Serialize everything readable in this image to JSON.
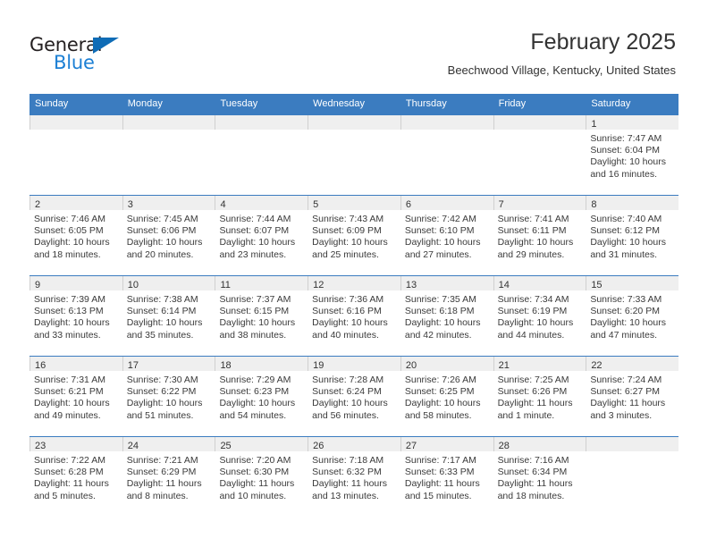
{
  "brand": {
    "name_part1": "General",
    "name_part2": "Blue",
    "triangle_icon": "triangle-icon",
    "accent_color": "#1b7fd4",
    "logo_dark_color": "#231f20"
  },
  "header": {
    "title": "February 2025",
    "subtitle": "Beechwood Village, Kentucky, United States"
  },
  "theme": {
    "header_blue": "#3b7cc0",
    "day_band_gray": "#efefef",
    "text_color": "#333333"
  },
  "calendar": {
    "weekdays": [
      "Sunday",
      "Monday",
      "Tuesday",
      "Wednesday",
      "Thursday",
      "Friday",
      "Saturday"
    ],
    "weeks": [
      [
        {
          "day": "",
          "empty": true,
          "sunrise": "",
          "sunset": "",
          "daylight_line1": "",
          "daylight_line2": ""
        },
        {
          "day": "",
          "empty": true,
          "sunrise": "",
          "sunset": "",
          "daylight_line1": "",
          "daylight_line2": ""
        },
        {
          "day": "",
          "empty": true,
          "sunrise": "",
          "sunset": "",
          "daylight_line1": "",
          "daylight_line2": ""
        },
        {
          "day": "",
          "empty": true,
          "sunrise": "",
          "sunset": "",
          "daylight_line1": "",
          "daylight_line2": ""
        },
        {
          "day": "",
          "empty": true,
          "sunrise": "",
          "sunset": "",
          "daylight_line1": "",
          "daylight_line2": ""
        },
        {
          "day": "",
          "empty": true,
          "sunrise": "",
          "sunset": "",
          "daylight_line1": "",
          "daylight_line2": ""
        },
        {
          "day": "1",
          "sunrise": "Sunrise: 7:47 AM",
          "sunset": "Sunset: 6:04 PM",
          "daylight_line1": "Daylight: 10 hours",
          "daylight_line2": "and 16 minutes."
        }
      ],
      [
        {
          "day": "2",
          "sunrise": "Sunrise: 7:46 AM",
          "sunset": "Sunset: 6:05 PM",
          "daylight_line1": "Daylight: 10 hours",
          "daylight_line2": "and 18 minutes."
        },
        {
          "day": "3",
          "sunrise": "Sunrise: 7:45 AM",
          "sunset": "Sunset: 6:06 PM",
          "daylight_line1": "Daylight: 10 hours",
          "daylight_line2": "and 20 minutes."
        },
        {
          "day": "4",
          "sunrise": "Sunrise: 7:44 AM",
          "sunset": "Sunset: 6:07 PM",
          "daylight_line1": "Daylight: 10 hours",
          "daylight_line2": "and 23 minutes."
        },
        {
          "day": "5",
          "sunrise": "Sunrise: 7:43 AM",
          "sunset": "Sunset: 6:09 PM",
          "daylight_line1": "Daylight: 10 hours",
          "daylight_line2": "and 25 minutes."
        },
        {
          "day": "6",
          "sunrise": "Sunrise: 7:42 AM",
          "sunset": "Sunset: 6:10 PM",
          "daylight_line1": "Daylight: 10 hours",
          "daylight_line2": "and 27 minutes."
        },
        {
          "day": "7",
          "sunrise": "Sunrise: 7:41 AM",
          "sunset": "Sunset: 6:11 PM",
          "daylight_line1": "Daylight: 10 hours",
          "daylight_line2": "and 29 minutes."
        },
        {
          "day": "8",
          "sunrise": "Sunrise: 7:40 AM",
          "sunset": "Sunset: 6:12 PM",
          "daylight_line1": "Daylight: 10 hours",
          "daylight_line2": "and 31 minutes."
        }
      ],
      [
        {
          "day": "9",
          "sunrise": "Sunrise: 7:39 AM",
          "sunset": "Sunset: 6:13 PM",
          "daylight_line1": "Daylight: 10 hours",
          "daylight_line2": "and 33 minutes."
        },
        {
          "day": "10",
          "sunrise": "Sunrise: 7:38 AM",
          "sunset": "Sunset: 6:14 PM",
          "daylight_line1": "Daylight: 10 hours",
          "daylight_line2": "and 35 minutes."
        },
        {
          "day": "11",
          "sunrise": "Sunrise: 7:37 AM",
          "sunset": "Sunset: 6:15 PM",
          "daylight_line1": "Daylight: 10 hours",
          "daylight_line2": "and 38 minutes."
        },
        {
          "day": "12",
          "sunrise": "Sunrise: 7:36 AM",
          "sunset": "Sunset: 6:16 PM",
          "daylight_line1": "Daylight: 10 hours",
          "daylight_line2": "and 40 minutes."
        },
        {
          "day": "13",
          "sunrise": "Sunrise: 7:35 AM",
          "sunset": "Sunset: 6:18 PM",
          "daylight_line1": "Daylight: 10 hours",
          "daylight_line2": "and 42 minutes."
        },
        {
          "day": "14",
          "sunrise": "Sunrise: 7:34 AM",
          "sunset": "Sunset: 6:19 PM",
          "daylight_line1": "Daylight: 10 hours",
          "daylight_line2": "and 44 minutes."
        },
        {
          "day": "15",
          "sunrise": "Sunrise: 7:33 AM",
          "sunset": "Sunset: 6:20 PM",
          "daylight_line1": "Daylight: 10 hours",
          "daylight_line2": "and 47 minutes."
        }
      ],
      [
        {
          "day": "16",
          "sunrise": "Sunrise: 7:31 AM",
          "sunset": "Sunset: 6:21 PM",
          "daylight_line1": "Daylight: 10 hours",
          "daylight_line2": "and 49 minutes."
        },
        {
          "day": "17",
          "sunrise": "Sunrise: 7:30 AM",
          "sunset": "Sunset: 6:22 PM",
          "daylight_line1": "Daylight: 10 hours",
          "daylight_line2": "and 51 minutes."
        },
        {
          "day": "18",
          "sunrise": "Sunrise: 7:29 AM",
          "sunset": "Sunset: 6:23 PM",
          "daylight_line1": "Daylight: 10 hours",
          "daylight_line2": "and 54 minutes."
        },
        {
          "day": "19",
          "sunrise": "Sunrise: 7:28 AM",
          "sunset": "Sunset: 6:24 PM",
          "daylight_line1": "Daylight: 10 hours",
          "daylight_line2": "and 56 minutes."
        },
        {
          "day": "20",
          "sunrise": "Sunrise: 7:26 AM",
          "sunset": "Sunset: 6:25 PM",
          "daylight_line1": "Daylight: 10 hours",
          "daylight_line2": "and 58 minutes."
        },
        {
          "day": "21",
          "sunrise": "Sunrise: 7:25 AM",
          "sunset": "Sunset: 6:26 PM",
          "daylight_line1": "Daylight: 11 hours",
          "daylight_line2": "and 1 minute."
        },
        {
          "day": "22",
          "sunrise": "Sunrise: 7:24 AM",
          "sunset": "Sunset: 6:27 PM",
          "daylight_line1": "Daylight: 11 hours",
          "daylight_line2": "and 3 minutes."
        }
      ],
      [
        {
          "day": "23",
          "sunrise": "Sunrise: 7:22 AM",
          "sunset": "Sunset: 6:28 PM",
          "daylight_line1": "Daylight: 11 hours",
          "daylight_line2": "and 5 minutes."
        },
        {
          "day": "24",
          "sunrise": "Sunrise: 7:21 AM",
          "sunset": "Sunset: 6:29 PM",
          "daylight_line1": "Daylight: 11 hours",
          "daylight_line2": "and 8 minutes."
        },
        {
          "day": "25",
          "sunrise": "Sunrise: 7:20 AM",
          "sunset": "Sunset: 6:30 PM",
          "daylight_line1": "Daylight: 11 hours",
          "daylight_line2": "and 10 minutes."
        },
        {
          "day": "26",
          "sunrise": "Sunrise: 7:18 AM",
          "sunset": "Sunset: 6:32 PM",
          "daylight_line1": "Daylight: 11 hours",
          "daylight_line2": "and 13 minutes."
        },
        {
          "day": "27",
          "sunrise": "Sunrise: 7:17 AM",
          "sunset": "Sunset: 6:33 PM",
          "daylight_line1": "Daylight: 11 hours",
          "daylight_line2": "and 15 minutes."
        },
        {
          "day": "28",
          "sunrise": "Sunrise: 7:16 AM",
          "sunset": "Sunset: 6:34 PM",
          "daylight_line1": "Daylight: 11 hours",
          "daylight_line2": "and 18 minutes."
        },
        {
          "day": "",
          "empty": true,
          "sunrise": "",
          "sunset": "",
          "daylight_line1": "",
          "daylight_line2": ""
        }
      ]
    ]
  }
}
